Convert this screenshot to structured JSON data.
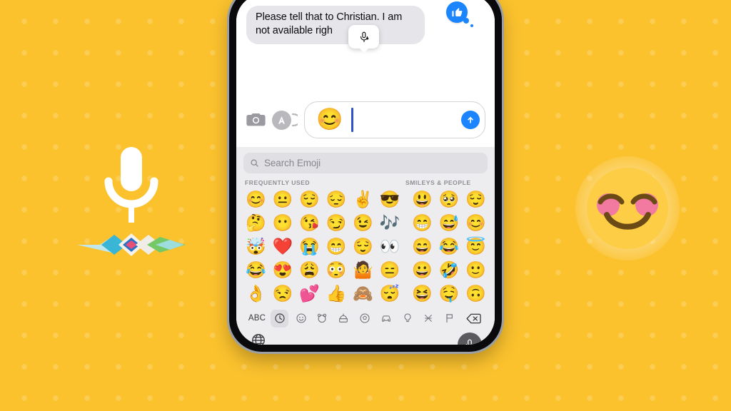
{
  "background": {
    "color": "#fbc22e",
    "dot_color": "#ffffff"
  },
  "left_decoration": {
    "icon": "microphone-icon",
    "waveform": "siri-waveform",
    "waveform_colors": [
      "#2f6fd0",
      "#35c3e8",
      "#e8497b",
      "#7fd46a",
      "#f0f0f0"
    ]
  },
  "right_decoration": {
    "icon": "smiling-face-with-smiling-eyes-emoji",
    "face_color": "#fccd45",
    "blush_color": "#f2799f",
    "stroke_color": "#6b4a16"
  },
  "phone": {
    "frame_color": "#0a0a0c",
    "edge_color": "#9aa0a6",
    "screen_color": "#ffffff"
  },
  "conversation": {
    "message": {
      "text": "Please tell that to Christian. I am not available righ",
      "bubble_color": "#e6e5ea",
      "text_color": "#0b0b0c"
    },
    "tapback": {
      "icon": "thumbs-up-icon",
      "color": "#1a85ff"
    },
    "tooltip": {
      "icon": "dictation-mic-icon"
    }
  },
  "input_bar": {
    "camera_icon": "camera-icon",
    "appstore_icon": "app-store-icon",
    "field_emoji": "😊",
    "caret_color": "#2f52c9",
    "send_icon": "send-arrow-up-icon",
    "send_color": "#1a85ff"
  },
  "keyboard": {
    "background": "#ededf0",
    "search": {
      "placeholder": "Search Emoji",
      "icon": "search-icon",
      "field_color": "#e0e0e4"
    },
    "sections": [
      {
        "title": "FREQUENTLY USED"
      },
      {
        "title": "SMILEYS & PEOPLE"
      }
    ],
    "frequently_used": [
      "😊",
      "😐",
      "😌",
      "😔",
      "✌️",
      "😎",
      "🤔",
      "😶",
      "😘",
      "😏",
      "😉",
      "🎶",
      "🤯",
      "❤️",
      "😭",
      "😁",
      "😌",
      "👀",
      "😂",
      "😍",
      "😩",
      "😳",
      "🤷",
      "😑",
      "👌",
      "😒",
      "💕",
      "👍",
      "🙈",
      "😴"
    ],
    "smileys_people": [
      "😃",
      "🥺",
      "😌",
      "😁",
      "😅",
      "😊",
      "😄",
      "😂",
      "😇",
      "😀",
      "🤣",
      "🙂",
      "😆",
      "🤤",
      "🙃"
    ],
    "categories": [
      {
        "label": "ABC",
        "icon": "abc-label",
        "selected": false
      },
      {
        "label": "",
        "icon": "clock-icon",
        "selected": true
      },
      {
        "label": "",
        "icon": "smiley-icon",
        "selected": false
      },
      {
        "label": "",
        "icon": "animal-icon",
        "selected": false
      },
      {
        "label": "",
        "icon": "food-icon",
        "selected": false
      },
      {
        "label": "",
        "icon": "activity-ball-icon",
        "selected": false
      },
      {
        "label": "",
        "icon": "travel-car-icon",
        "selected": false
      },
      {
        "label": "",
        "icon": "objects-bulb-icon",
        "selected": false
      },
      {
        "label": "",
        "icon": "symbols-icon",
        "selected": false
      },
      {
        "label": "",
        "icon": "flag-icon",
        "selected": false
      },
      {
        "label": "",
        "icon": "backspace-delete-icon",
        "selected": false
      }
    ]
  },
  "bottom_bar": {
    "globe_icon": "globe-language-icon",
    "mic_icon": "dictation-microphone-icon",
    "mic_button_color": "#5a5a5f",
    "home_indicator": "home-indicator"
  }
}
